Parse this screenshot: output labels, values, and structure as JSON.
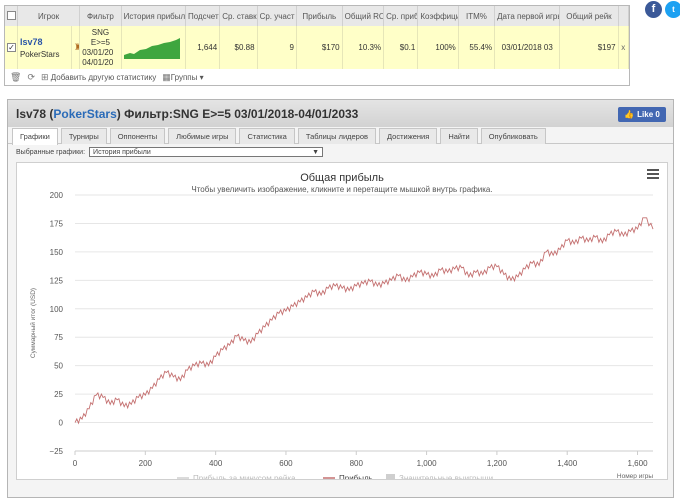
{
  "stats": {
    "headers": [
      "Игрок",
      "Фильтр",
      "История прибыли",
      "Подсчет",
      "Ср. ставка",
      "Ср. участ",
      "Прибыль",
      "Общий ROI",
      "Ср. прибыль",
      "Коэффициент",
      "ITM%",
      "Дата первой игры",
      "Общий рейк"
    ],
    "row": {
      "checked": "✓",
      "player": "lsv78",
      "site": "PokerStars",
      "filter_lines": [
        "SNG",
        "E>=5",
        "03/01/20",
        "04/01/20"
      ],
      "count": "1,644",
      "avg_stake": "$0.88",
      "avg_entrants": "9",
      "profit": "$170",
      "roi": "10.3%",
      "avg_profit": "$0.1",
      "ratio": "100%",
      "itm": "55.4%",
      "first_date": "03/01/2018 03",
      "rake": "$197",
      "close": "x"
    },
    "footer": {
      "add_label": "Добавить другую статистику",
      "groups_label": "Группы"
    }
  },
  "panel": {
    "title_player": "lsv78",
    "title_site": "PokerStars",
    "title_rest": "Фильтр:SNG E>=5 03/01/2018-04/01/2033",
    "like_label": "Like 0",
    "tabs": [
      "Графики",
      "Турниры",
      "Оппоненты",
      "Любимые игры",
      "Статистика",
      "Таблицы лидеров",
      "Достижения",
      "Найти",
      "Опубликовать"
    ],
    "select_label": "Выбранные графики:",
    "select_value": "История прибыли"
  },
  "colors": {
    "accent": "#2a6bb8",
    "profit_line": "#c47070",
    "highlight_row": "#ffffc8",
    "facebook": "#3b5998"
  },
  "chart_data": {
    "type": "line",
    "title": "Общая прибыль",
    "subtitle": "Чтобы увеличить изображение, кликните и перетащите мышкой внутрь графика.",
    "ylabel": "Суммарный итог (USD)",
    "xlabel": "Номер игры",
    "xlim": [
      0,
      1644
    ],
    "ylim": [
      -25,
      200
    ],
    "xticks": [
      0,
      200,
      400,
      600,
      800,
      1000,
      1200,
      1400,
      1600
    ],
    "xtick_labels": [
      "0",
      "200",
      "400",
      "600",
      "800",
      "1,000",
      "1,200",
      "1,400",
      "1,600"
    ],
    "yticks": [
      -25,
      0,
      25,
      50,
      75,
      100,
      125,
      150,
      175,
      200
    ],
    "ytick_labels": [
      "−25",
      "0",
      "25",
      "50",
      "75",
      "100",
      "125",
      "150",
      "175",
      "200"
    ],
    "legend": [
      "Прибыль за минусом рейка",
      "Прибыль",
      "Значительные выигрыши"
    ],
    "series": [
      {
        "name": "Прибыль",
        "x": [
          0,
          20,
          40,
          60,
          80,
          100,
          120,
          140,
          160,
          180,
          200,
          220,
          240,
          260,
          280,
          300,
          320,
          340,
          360,
          380,
          400,
          420,
          440,
          460,
          480,
          500,
          520,
          540,
          560,
          580,
          600,
          620,
          640,
          660,
          680,
          700,
          720,
          740,
          760,
          780,
          800,
          820,
          840,
          860,
          880,
          900,
          920,
          940,
          960,
          980,
          1000,
          1020,
          1040,
          1060,
          1080,
          1100,
          1120,
          1140,
          1160,
          1180,
          1200,
          1220,
          1240,
          1260,
          1280,
          1300,
          1320,
          1340,
          1360,
          1380,
          1400,
          1420,
          1440,
          1460,
          1480,
          1500,
          1520,
          1540,
          1560,
          1580,
          1600,
          1620,
          1644
        ],
        "values": [
          0,
          3,
          12,
          24,
          22,
          16,
          20,
          14,
          16,
          22,
          24,
          30,
          38,
          44,
          40,
          37,
          46,
          50,
          52,
          50,
          58,
          64,
          68,
          76,
          72,
          70,
          78,
          84,
          90,
          96,
          98,
          102,
          106,
          110,
          115,
          112,
          118,
          120,
          118,
          116,
          120,
          122,
          124,
          120,
          122,
          125,
          129,
          124,
          128,
          132,
          130,
          128,
          134,
          132,
          135,
          136,
          128,
          132,
          130,
          136,
          137,
          130,
          125,
          128,
          135,
          140,
          138,
          150,
          147,
          152,
          160,
          157,
          162,
          159,
          163,
          158,
          165,
          168,
          164,
          168,
          170,
          180,
          170
        ]
      }
    ]
  }
}
